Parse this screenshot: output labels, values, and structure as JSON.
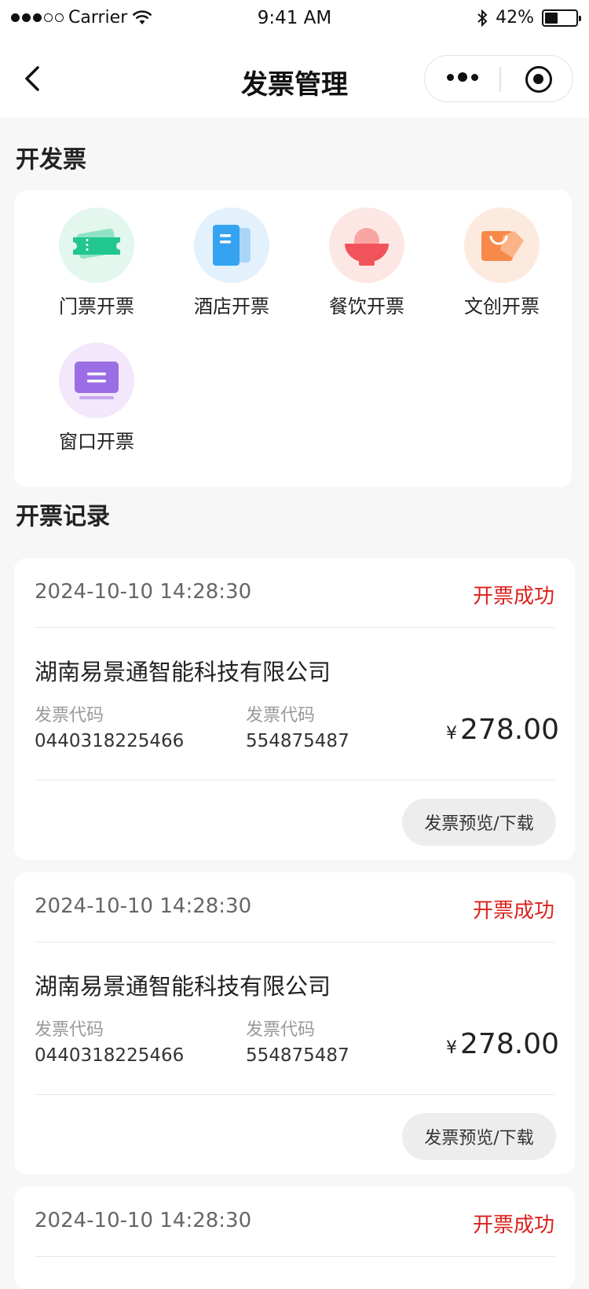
{
  "status_bar": {
    "carrier": "Carrier",
    "time": "9:41 AM",
    "battery_percent": "42%",
    "battery_level": 0.42
  },
  "nav": {
    "title": "发票管理"
  },
  "issue_section": {
    "title": "开发票",
    "items": [
      {
        "label": "门票开票",
        "icon": "ticket-icon",
        "color": "#21c78f",
        "bg": "#e3f7ef"
      },
      {
        "label": "酒店开票",
        "icon": "hotel-doc-icon",
        "color": "#35a3f2",
        "bg": "#e3f1fd"
      },
      {
        "label": "餐饮开票",
        "icon": "food-bowl-icon",
        "color": "#f0545a",
        "bg": "#fde7e5"
      },
      {
        "label": "文创开票",
        "icon": "creative-tag-icon",
        "color": "#f78a4a",
        "bg": "#fdeadf"
      },
      {
        "label": "窗口开票",
        "icon": "window-counter-icon",
        "color": "#9b6ee6",
        "bg": "#f3e7fb"
      }
    ]
  },
  "records_section": {
    "title": "开票记录",
    "records": [
      {
        "time": "2024-10-10 14:28:30",
        "status": "开票成功",
        "company": "湖南易景通智能科技有限公司",
        "label1": "发票代码",
        "value1": "0440318225466",
        "label2": "发票代码",
        "value2": "554875487",
        "currency": "¥",
        "amount": "278.00",
        "button": "发票预览/下载"
      },
      {
        "time": "2024-10-10 14:28:30",
        "status": "开票成功",
        "company": "湖南易景通智能科技有限公司",
        "label1": "发票代码",
        "value1": "0440318225466",
        "label2": "发票代码",
        "value2": "554875487",
        "currency": "¥",
        "amount": "278.00",
        "button": "发票预览/下载"
      },
      {
        "time": "2024-10-10 14:28:30",
        "status": "开票成功"
      }
    ]
  },
  "colors": {
    "status_success": "#d9221c",
    "page_bg": "#f7f7f7"
  }
}
